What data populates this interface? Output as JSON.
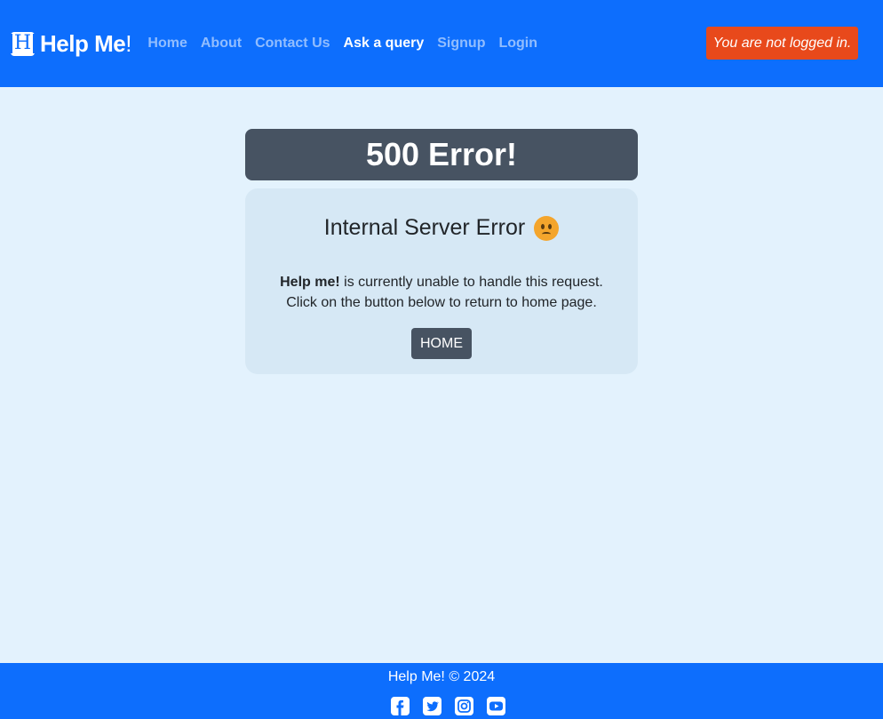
{
  "brand": {
    "name": "Help Me",
    "bang": "!",
    "logo_letter": "H"
  },
  "nav": {
    "items": [
      {
        "label": "Home",
        "active": false
      },
      {
        "label": "About",
        "active": false
      },
      {
        "label": "Contact Us",
        "active": false
      },
      {
        "label": "Ask a query",
        "active": true
      },
      {
        "label": "Signup",
        "active": false
      },
      {
        "label": "Login",
        "active": false
      }
    ],
    "login_status": "You are not logged in."
  },
  "error": {
    "heading": "500 Error!",
    "title": "Internal Server Error",
    "message_bold": "Help me!",
    "message_rest": " is currently unable to handle this request.",
    "message_line2": "Click on the button below to return to home page.",
    "button_label": "HOME",
    "emoji_icon": "sad-face-icon"
  },
  "footer": {
    "text": "Help Me! © 2024",
    "socials": [
      "facebook-icon",
      "twitter-icon",
      "instagram-icon",
      "youtube-icon"
    ]
  },
  "colors": {
    "navbar": "#0d6efd",
    "background": "#e3f2fd",
    "error_header": "#475362",
    "card": "#d6e8f5",
    "login_badge": "#e8491b"
  }
}
